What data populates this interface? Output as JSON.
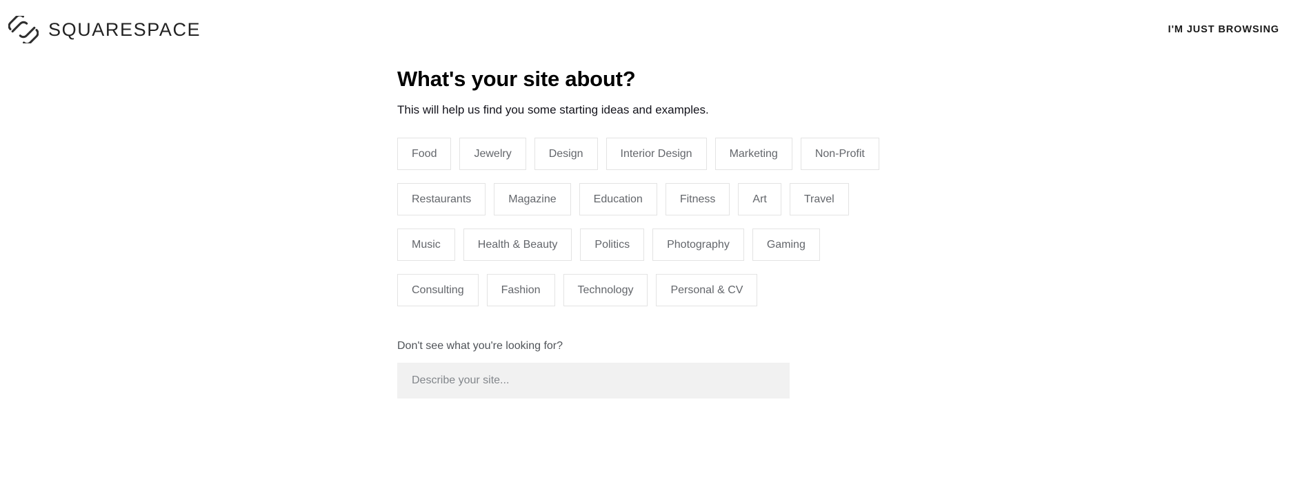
{
  "header": {
    "logo_icon": "squarespace-logo-icon",
    "wordmark": "SQUARESPACE",
    "browsing_label": "I'M JUST BROWSING"
  },
  "main": {
    "title": "What's your site about?",
    "subtitle": "This will help us find you some starting ideas and examples.",
    "tags": [
      "Food",
      "Jewelry",
      "Design",
      "Interior Design",
      "Marketing",
      "Non-Profit",
      "Restaurants",
      "Magazine",
      "Education",
      "Fitness",
      "Art",
      "Travel",
      "Music",
      "Health & Beauty",
      "Politics",
      "Photography",
      "Gaming",
      "Consulting",
      "Fashion",
      "Technology",
      "Personal & CV"
    ],
    "describe": {
      "label": "Don't see what you're looking for?",
      "placeholder": "Describe your site...",
      "value": ""
    }
  },
  "colors": {
    "background": "#ffffff",
    "title": "#000000",
    "tag_text": "#63666b",
    "tag_border": "#e3e3e3",
    "input_background": "#f1f1f1",
    "placeholder": "#82868b"
  }
}
